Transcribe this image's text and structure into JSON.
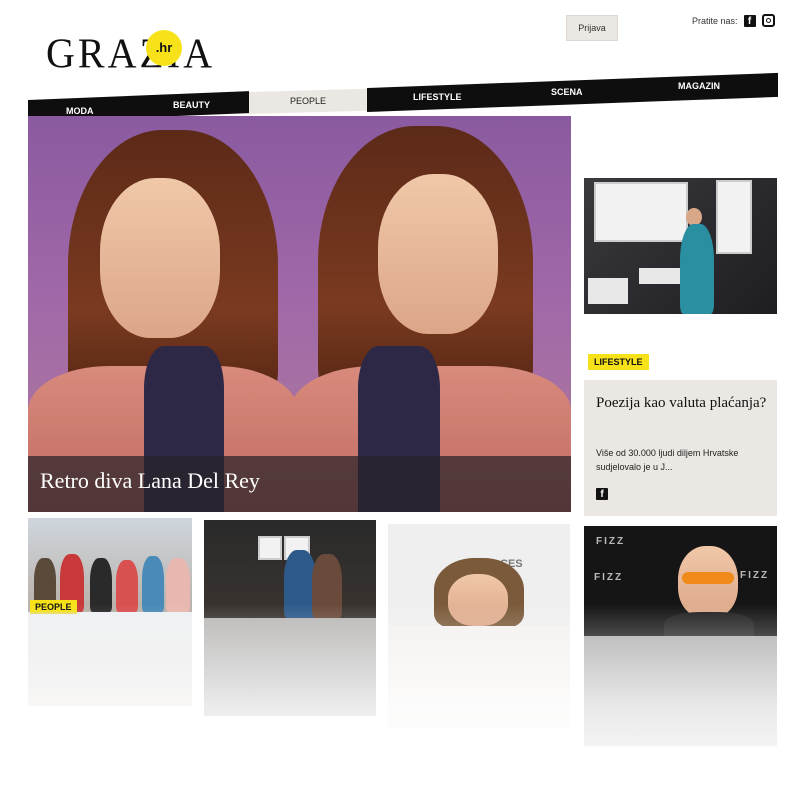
{
  "header": {
    "logo_text": "GRAZIA",
    "logo_domain": ".hr",
    "login_label": "Prijava",
    "follow_label": "Pratite nas:",
    "social": [
      {
        "name": "facebook-icon",
        "glyph": "f"
      },
      {
        "name": "instagram-icon",
        "glyph": ""
      }
    ]
  },
  "nav": {
    "items": [
      {
        "label": "MODA"
      },
      {
        "label": "BEAUTY"
      },
      {
        "label": "PEOPLE"
      },
      {
        "label": "LIFESTYLE"
      },
      {
        "label": "SCENA"
      },
      {
        "label": "MAGAZIN"
      }
    ],
    "active": "PEOPLE"
  },
  "hero": {
    "title": "Retro diva Lana Del Rey"
  },
  "side": {
    "badge": "LIFESTYLE",
    "card_title": "Poezija kao valuta plaćanja?",
    "card_text": "Više od 30.000 ljudi diljem Hrvatske sudjelovalo je u J...",
    "card_icon": "f"
  },
  "bottom": {
    "badge": "PEOPLE",
    "thumb3_text": "CES",
    "thumb4_brand": "FIZZ"
  },
  "colors": {
    "accent": "#f7e21a",
    "nav_bg": "#0e0e0e",
    "panel_bg": "#ebe8e3"
  }
}
